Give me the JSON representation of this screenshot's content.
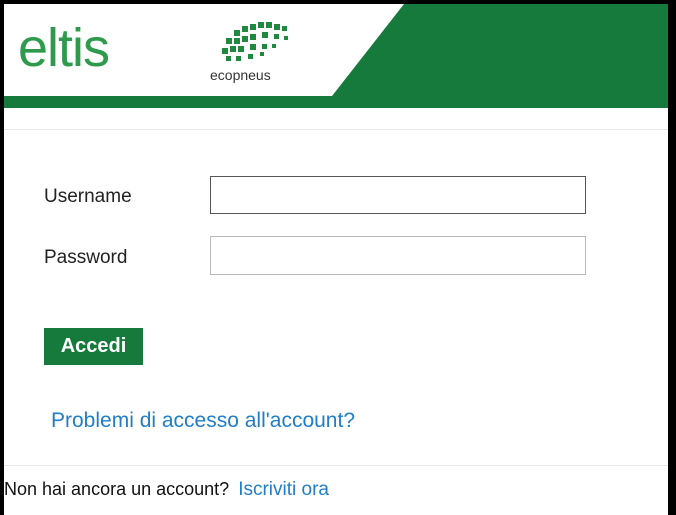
{
  "brand": {
    "logo_text": "eltis",
    "partner_text": "ecopneus",
    "primary_color": "#167a3d"
  },
  "form": {
    "username_label": "Username",
    "password_label": "Password",
    "username_value": "",
    "password_value": "",
    "submit_label": "Accedi"
  },
  "links": {
    "account_problems": "Problemi di accesso all'account?",
    "no_account_text": "Non hai ancora un account?",
    "signup": "Iscriviti ora"
  }
}
